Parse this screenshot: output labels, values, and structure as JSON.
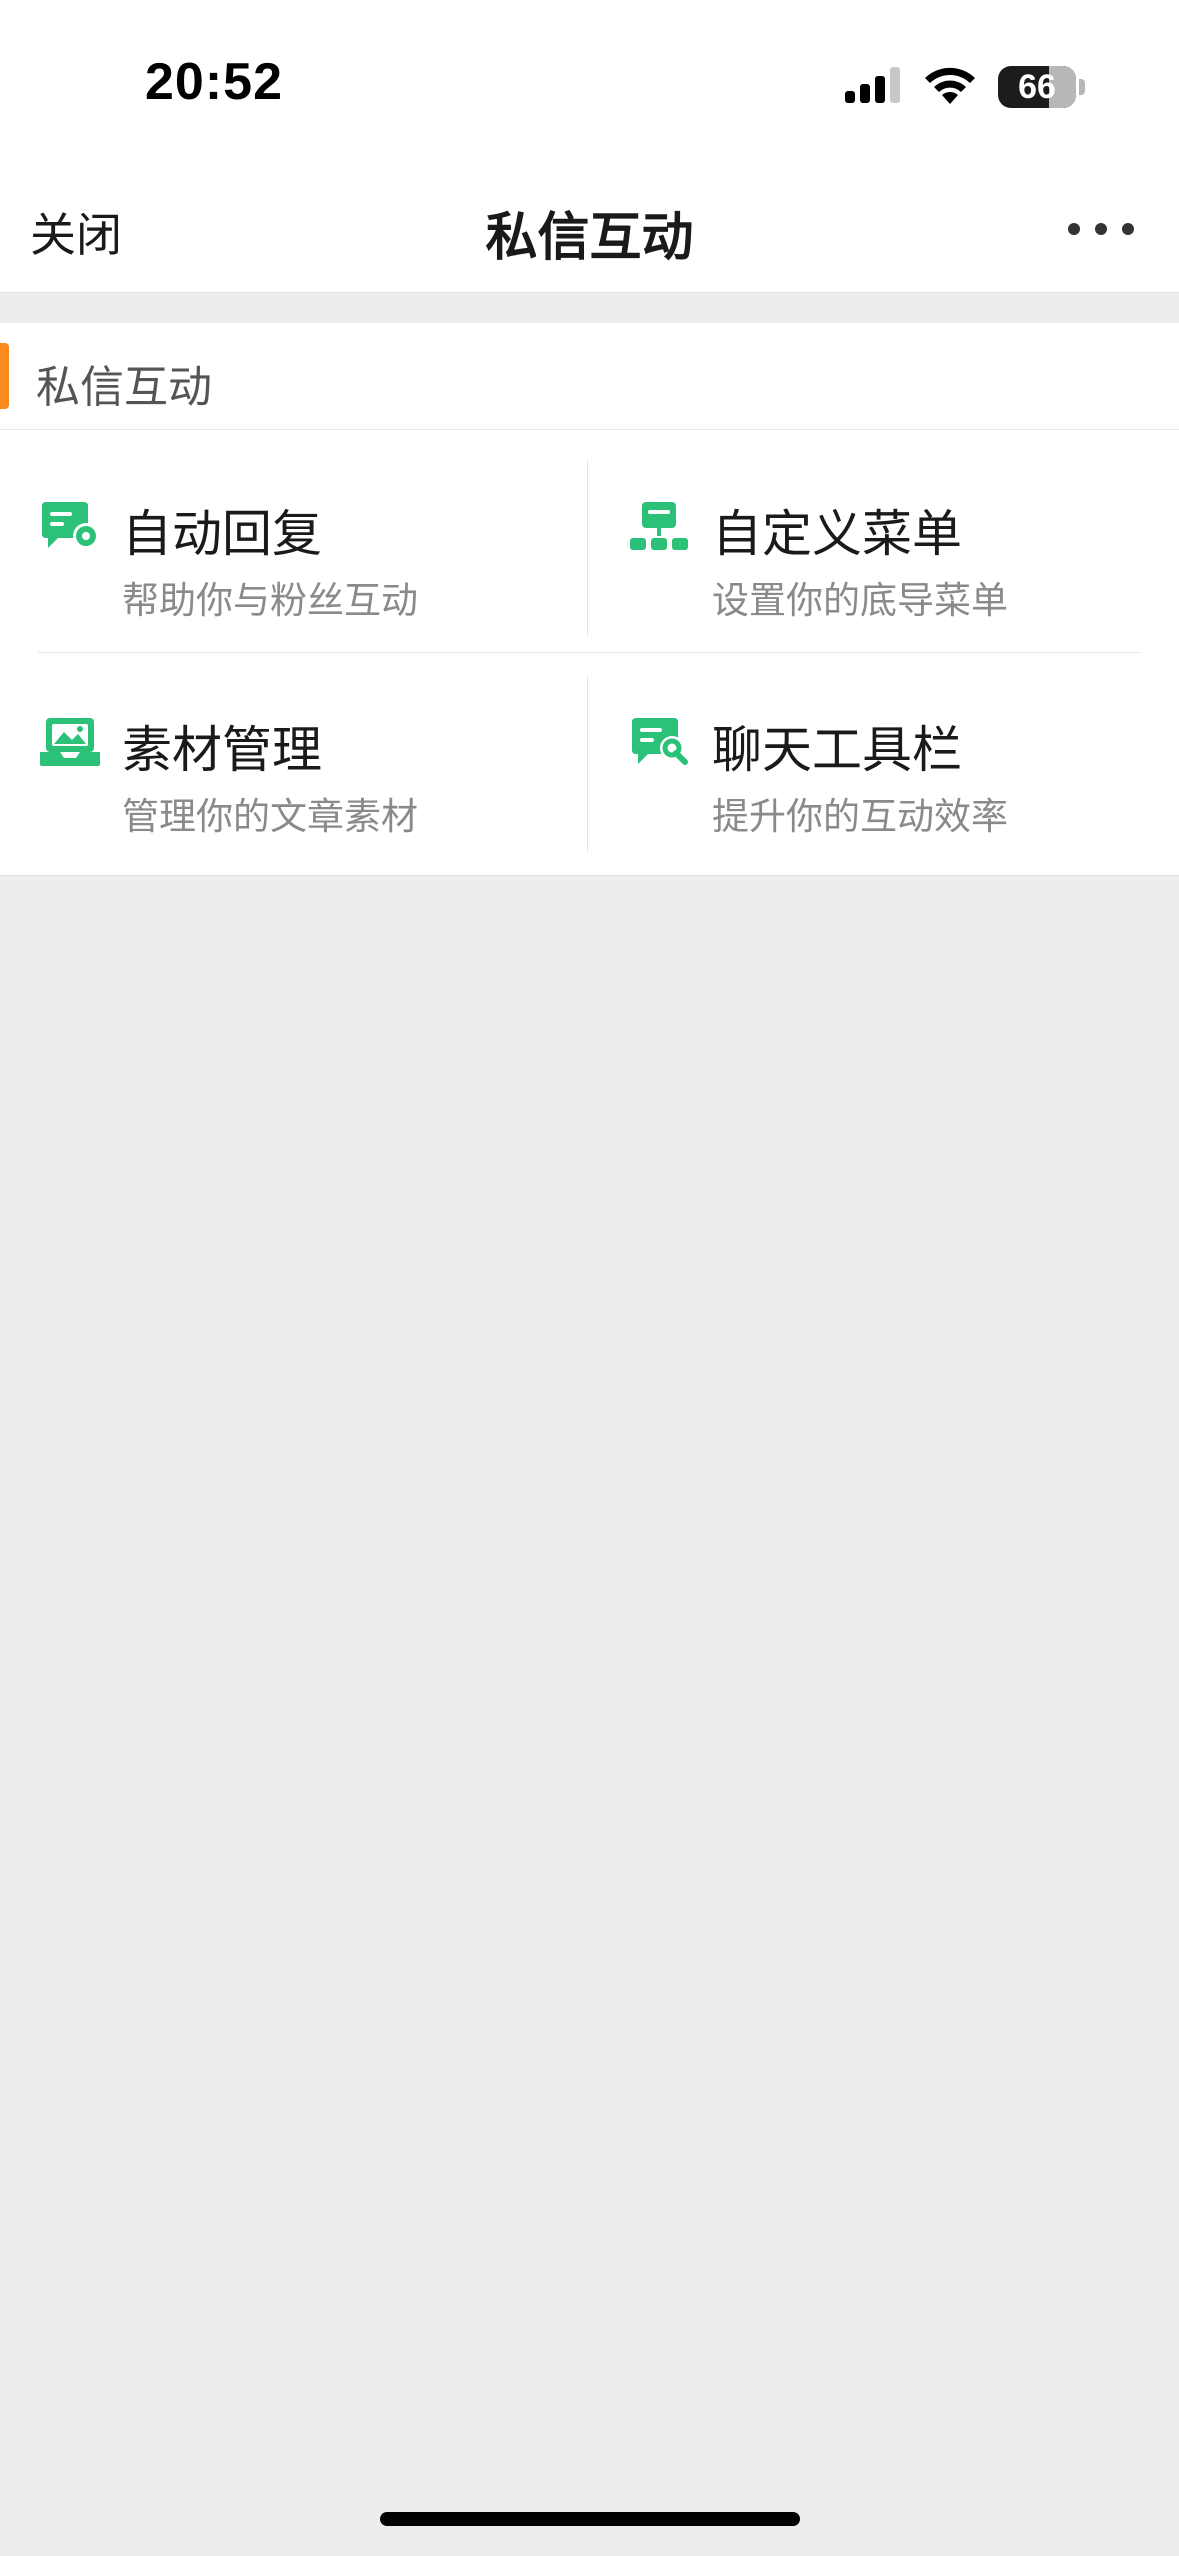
{
  "status_bar": {
    "time": "20:52",
    "battery_percent": "66",
    "battery_level": 0.66
  },
  "nav": {
    "close_label": "关闭",
    "title": "私信互动",
    "more_icon": "more-dots-icon"
  },
  "section": {
    "title": "私信互动",
    "accent_color": "#fa8a1e"
  },
  "tiles": [
    {
      "title": "自动回复",
      "subtitle": "帮助你与粉丝互动",
      "icon": "auto-reply-icon"
    },
    {
      "title": "自定义菜单",
      "subtitle": "设置你的底导菜单",
      "icon": "custom-menu-icon"
    },
    {
      "title": "素材管理",
      "subtitle": "管理你的文章素材",
      "icon": "material-icon"
    },
    {
      "title": "聊天工具栏",
      "subtitle": "提升你的互动效率",
      "icon": "chat-toolbar-icon"
    }
  ],
  "colors": {
    "icon_green": "#2cc179",
    "background": "#ededed"
  }
}
